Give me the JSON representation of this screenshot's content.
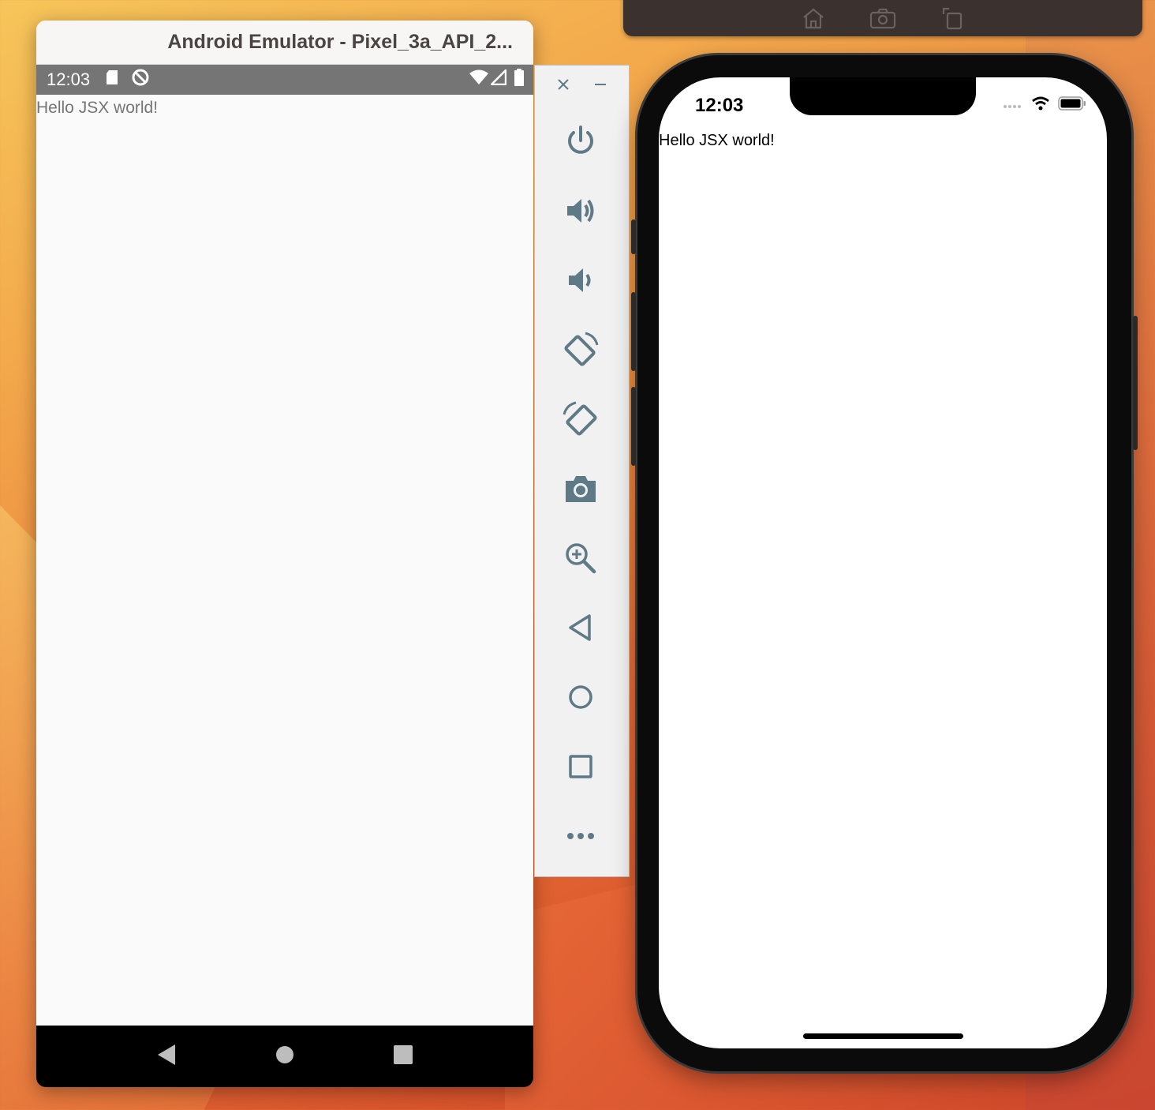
{
  "android": {
    "window_title": "Android Emulator - Pixel_3a_API_2...",
    "status_time": "12:03",
    "content_text": "Hello JSX world!",
    "nav_buttons": [
      "back-icon",
      "home-icon",
      "recents-icon"
    ]
  },
  "emulator_panel": {
    "window_controls": [
      "close-icon",
      "minimize-icon"
    ],
    "tools": [
      "power-icon",
      "volume-up-icon",
      "volume-down-icon",
      "rotate-left-icon",
      "rotate-right-icon",
      "camera-icon",
      "zoom-icon",
      "back-icon",
      "home-icon",
      "overview-icon",
      "more-icon"
    ]
  },
  "simulator_toolbar": {
    "buttons": [
      "home-icon",
      "screenshot-icon",
      "rotate-icon"
    ]
  },
  "ios": {
    "status_time": "12:03",
    "content_text": "Hello JSX world!"
  },
  "colors": {
    "android_status_bar": "#757575",
    "emulator_icon": "#5f7a87",
    "android_nav_bar": "#000000"
  }
}
